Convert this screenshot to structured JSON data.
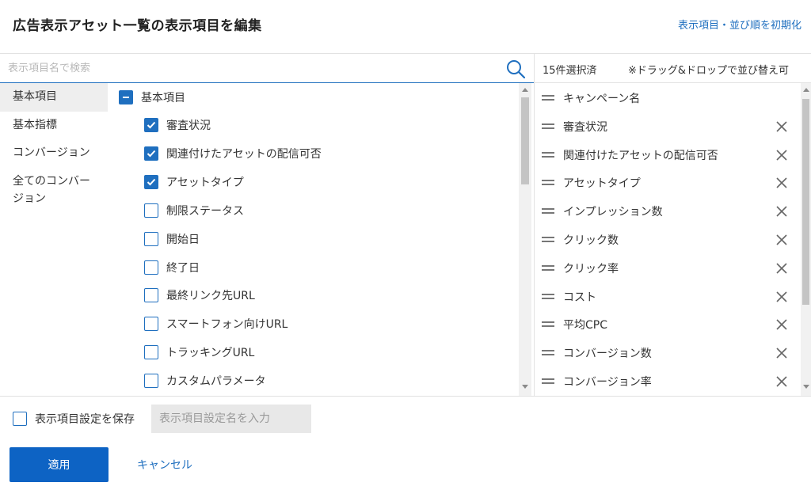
{
  "dialog": {
    "title": "広告表示アセット一覧の表示項目を編集",
    "reset_link": "表示項目・並び順を初期化"
  },
  "search": {
    "placeholder": "表示項目名で検索",
    "icon": "search-icon"
  },
  "selection": {
    "count_text": "15件選択済",
    "hint_text": "※ドラッグ&ドロップで並び替え可"
  },
  "categories": [
    {
      "label": "基本項目",
      "active": true
    },
    {
      "label": "基本指標",
      "active": false
    },
    {
      "label": "コンバージョン",
      "active": false
    },
    {
      "label": "全てのコンバー",
      "label_line2": "ジョン",
      "active": false
    }
  ],
  "field_group": {
    "label": "基本項目",
    "state": "partial",
    "items": [
      {
        "label": "審査状況",
        "checked": true
      },
      {
        "label": "関連付けたアセットの配信可否",
        "checked": true
      },
      {
        "label": "アセットタイプ",
        "checked": true
      },
      {
        "label": "制限ステータス",
        "checked": false
      },
      {
        "label": "開始日",
        "checked": false
      },
      {
        "label": "終了日",
        "checked": false
      },
      {
        "label": "最終リンク先URL",
        "checked": false
      },
      {
        "label": "スマートフォン向けURL",
        "checked": false
      },
      {
        "label": "トラッキングURL",
        "checked": false
      },
      {
        "label": "カスタムパラメータ",
        "checked": false
      }
    ]
  },
  "selected_items": [
    {
      "label": "キャンペーン名",
      "removable": false
    },
    {
      "label": "審査状況",
      "removable": true
    },
    {
      "label": "関連付けたアセットの配信可否",
      "removable": true
    },
    {
      "label": "アセットタイプ",
      "removable": true
    },
    {
      "label": "インプレッション数",
      "removable": true
    },
    {
      "label": "クリック数",
      "removable": true
    },
    {
      "label": "クリック率",
      "removable": true
    },
    {
      "label": "コスト",
      "removable": true
    },
    {
      "label": "平均CPC",
      "removable": true
    },
    {
      "label": "コンバージョン数",
      "removable": true
    },
    {
      "label": "コンバージョン率",
      "removable": true
    }
  ],
  "footer": {
    "save_label": "表示項目設定を保存",
    "save_checked": false,
    "setting_name_placeholder": "表示項目設定名を入力",
    "apply_label": "適用",
    "cancel_label": "キャンセル"
  },
  "colors": {
    "accent": "#1f6fbf",
    "apply_button": "#0d63c4",
    "active_category": "#eeeeee"
  }
}
